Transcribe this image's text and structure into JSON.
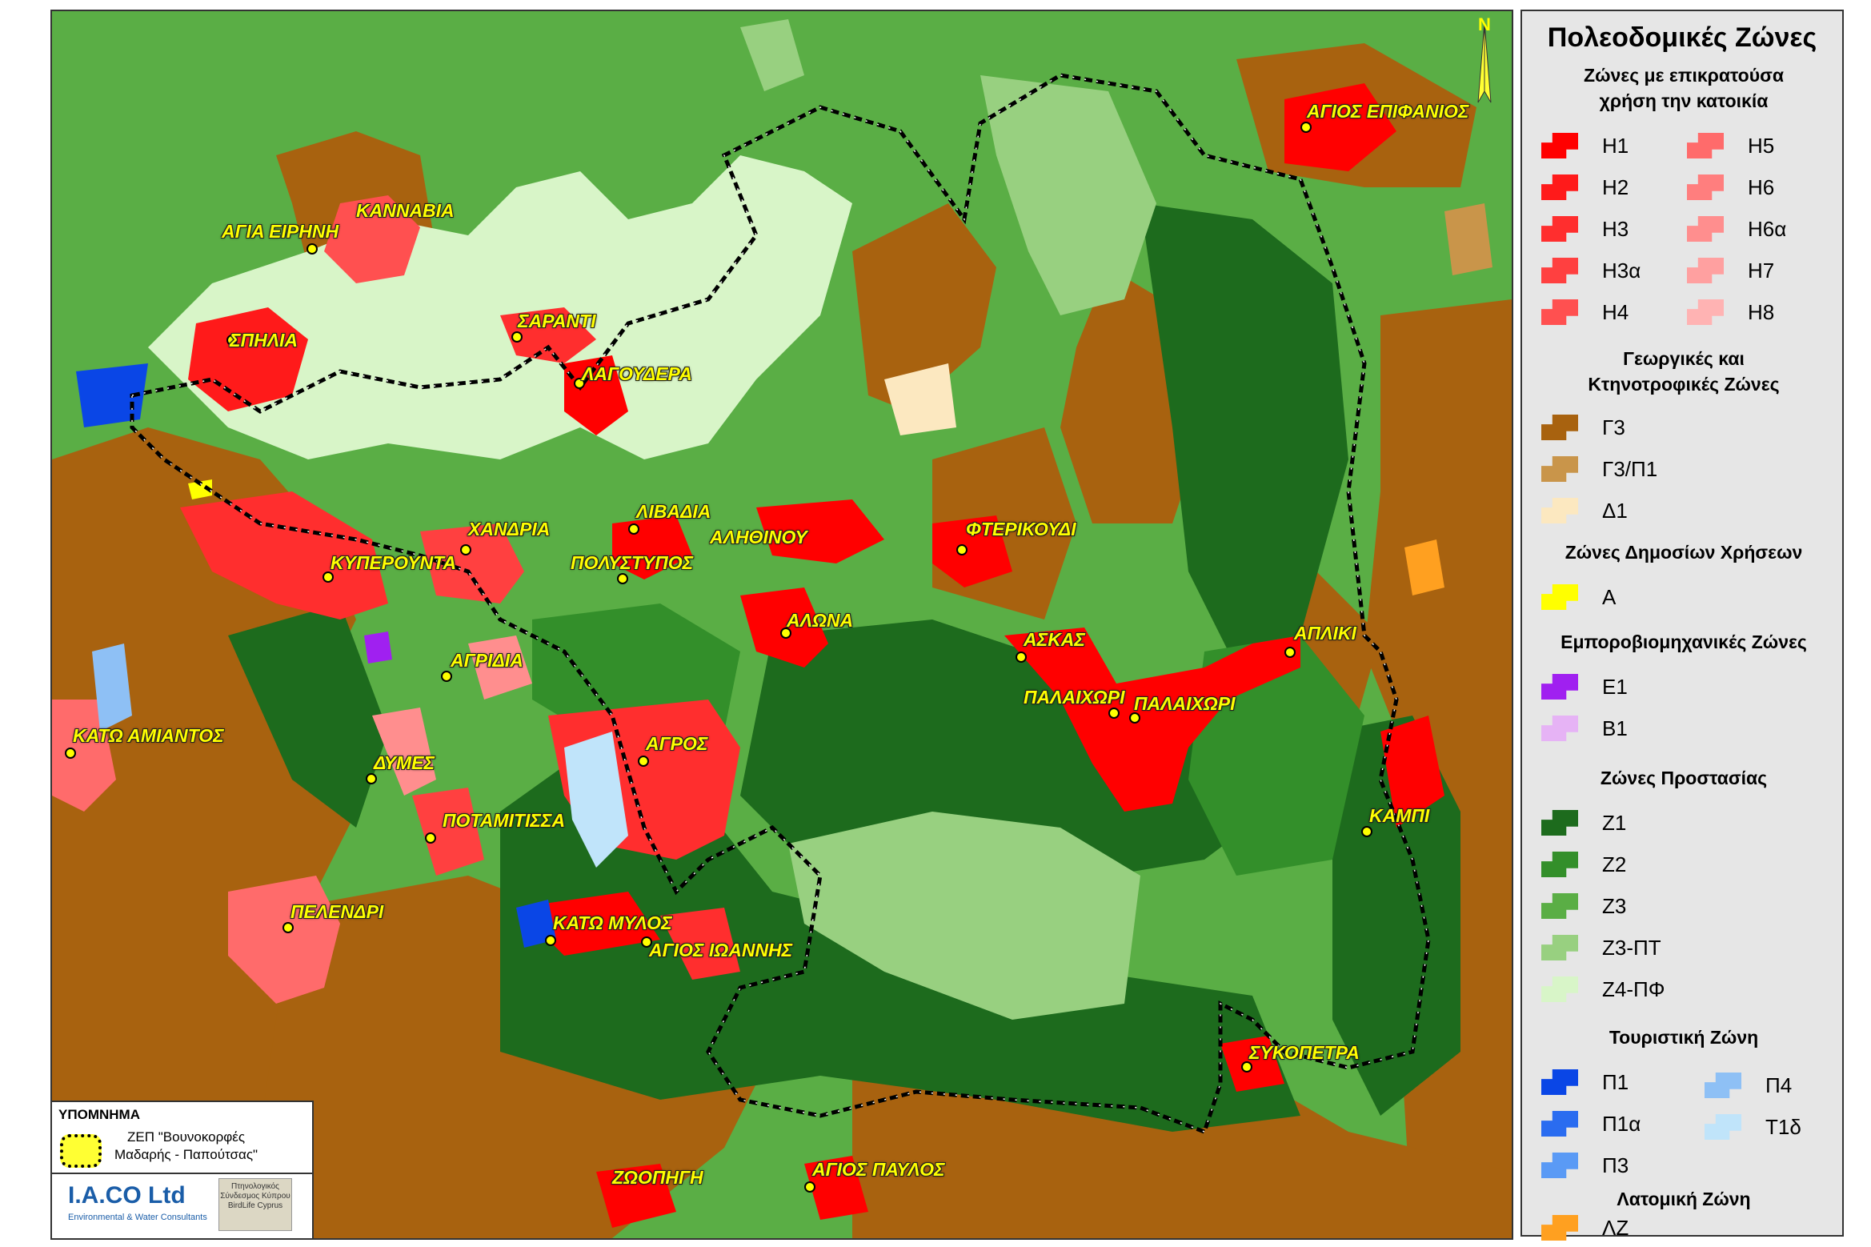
{
  "map": {
    "north_label": "N",
    "places": [
      {
        "name": "ΚΑΝΝΑΒΙΑ"
      },
      {
        "name": "ΑΓΙΑ ΕΙΡΗΝΗ"
      },
      {
        "name": "ΣΠΗΛΙΑ"
      },
      {
        "name": "ΣΑΡΑΝΤΙ"
      },
      {
        "name": "ΛΑΓΟΥΔΕΡΑ"
      },
      {
        "name": "ΑΓΙΟΣ ΕΠΙΦΑΝΙΟΣ"
      },
      {
        "name": "ΛΙΒΑΔΙΑ"
      },
      {
        "name": "ΑΛΗΘΙΝΟΥ"
      },
      {
        "name": "ΧΑΝΔΡΙΑ"
      },
      {
        "name": "ΚΥΠΕΡΟΥΝΤΑ"
      },
      {
        "name": "ΠΟΛΥΣΤΥΠΟΣ"
      },
      {
        "name": "ΦΤΕΡΙΚΟΥΔΙ"
      },
      {
        "name": "ΑΛΩΝΑ"
      },
      {
        "name": "ΑΣΚΑΣ"
      },
      {
        "name": "ΑΠΛΙΚΙ"
      },
      {
        "name": "ΑΓΡΙΔΙΑ"
      },
      {
        "name": "ΠΑΛΑΙΧΩΡΙ"
      },
      {
        "name": "ΠΑΛΑΙΧΩΡΙ"
      },
      {
        "name": "ΚΑΤΩ ΑΜΙΑΝΤΟΣ"
      },
      {
        "name": "ΑΓΡΟΣ"
      },
      {
        "name": "ΔΥΜΕΣ"
      },
      {
        "name": "ΚΑΜΠΙ"
      },
      {
        "name": "ΠΟΤΑΜΙΤΙΣΣΑ"
      },
      {
        "name": "ΠΕΛΕΝΔΡΙ"
      },
      {
        "name": "ΚΑΤΩ ΜΥΛΟΣ"
      },
      {
        "name": "ΑΓΙΟΣ ΙΩΑΝΝΗΣ"
      },
      {
        "name": "ΣΥΚΟΠΕΤΡΑ"
      },
      {
        "name": "ΖΩΟΠΗΓΗ"
      },
      {
        "name": "ΑΓΙΟΣ ΠΑΥΛΟΣ"
      }
    ]
  },
  "legend": {
    "title": "Πολεοδομικές Ζώνες",
    "groups": [
      {
        "heading": "Ζώνες με επικρατούσα\nχρήση την κατοικία",
        "items": [
          {
            "label": "Η1",
            "color": "#ff0000"
          },
          {
            "label": "Η2",
            "color": "#ff1a1a"
          },
          {
            "label": "Η3",
            "color": "#ff2e2e"
          },
          {
            "label": "Η3α",
            "color": "#ff4040"
          },
          {
            "label": "Η4",
            "color": "#ff5050"
          },
          {
            "label": "Η5",
            "color": "#ff6b6b"
          },
          {
            "label": "Η6",
            "color": "#ff7e7e"
          },
          {
            "label": "Η6α",
            "color": "#ff8e8e"
          },
          {
            "label": "Η7",
            "color": "#ffa0a0"
          },
          {
            "label": "Η8",
            "color": "#ffb3b3"
          }
        ]
      },
      {
        "heading": "Γεωργικές και\nΚτηνοτροφικές Ζώνες",
        "items": [
          {
            "label": "Γ3",
            "color": "#a8620f"
          },
          {
            "label": "Γ3/Π1",
            "color": "#c9954a"
          },
          {
            "label": "Δ1",
            "color": "#fce8c0"
          }
        ]
      },
      {
        "heading": "Ζώνες Δημοσίων Χρήσεων",
        "items": [
          {
            "label": "Α",
            "color": "#ffff00"
          }
        ]
      },
      {
        "heading": "Εμποροβιομηχανικές Ζώνες",
        "items": [
          {
            "label": "Ε1",
            "color": "#a020f0"
          },
          {
            "label": "Β1",
            "color": "#e6b3f5"
          }
        ]
      },
      {
        "heading": "Ζώνες Προστασίας",
        "items": [
          {
            "label": "Ζ1",
            "color": "#1d6b1d"
          },
          {
            "label": "Ζ2",
            "color": "#338f2a"
          },
          {
            "label": "Ζ3",
            "color": "#5aae45"
          },
          {
            "label": "Ζ3-ΠΤ",
            "color": "#98d080"
          },
          {
            "label": "Ζ4-ΠΦ",
            "color": "#d8f5c8"
          }
        ]
      },
      {
        "heading": "Τουριστική Ζώνη",
        "items": [
          {
            "label": "Π1",
            "color": "#0a46e6"
          },
          {
            "label": "Π1α",
            "color": "#2a6cf0"
          },
          {
            "label": "Π3",
            "color": "#5a9af5"
          },
          {
            "label": "Π4",
            "color": "#8ec0f5"
          },
          {
            "label": "Τ1δ",
            "color": "#c0e4fa"
          }
        ]
      },
      {
        "heading": "Λατομική Ζώνη",
        "items": [
          {
            "label": "ΛΖ",
            "color": "#ffa020"
          }
        ]
      }
    ]
  },
  "inset": {
    "title": "ΥΠΟΜΝΗΜΑ",
    "zep_label": "ΖΕΠ \"Βουνοκορφές\nΜαδαρής - Παπούτσας\"",
    "logo": "I.A.CO Ltd",
    "logo_sub": "Environmental & Water Consultants",
    "bird_caption": "Πτηνολογικός Σύνδεσμος Κύπρου BirdLife Cyprus"
  },
  "colors": {
    "boundary": "#000000",
    "place_label": "#ffff00"
  }
}
